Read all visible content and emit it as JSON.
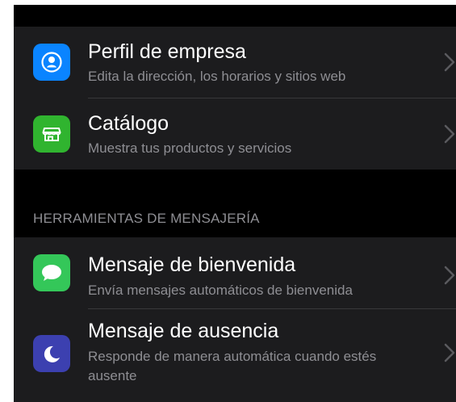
{
  "business_tools": {
    "items": [
      {
        "title": "Perfil de empresa",
        "subtitle": "Edita la dirección, los horarios y sitios web",
        "icon": "business-profile-icon",
        "icon_color": "#0a84ff"
      },
      {
        "title": "Catálogo",
        "subtitle": "Muestra tus productos y servicios",
        "icon": "storefront-icon",
        "icon_color": "#30b42f"
      }
    ]
  },
  "messaging_tools": {
    "header": "HERRAMIENTAS DE MENSAJERÍA",
    "items": [
      {
        "title": "Mensaje de bienvenida",
        "subtitle": "Envía mensajes automáticos de bienvenida",
        "icon": "chat-bubble-icon",
        "icon_color": "#34c759"
      },
      {
        "title": "Mensaje de ausencia",
        "subtitle": "Responde de manera automática cuando estés ausente",
        "icon": "moon-icon",
        "icon_color": "#3c40b0"
      }
    ]
  },
  "colors": {
    "background": "#000000",
    "group_background": "#1c1c1e",
    "primary_text": "#ffffff",
    "secondary_text": "#8e8e93",
    "separator": "#38383a"
  }
}
